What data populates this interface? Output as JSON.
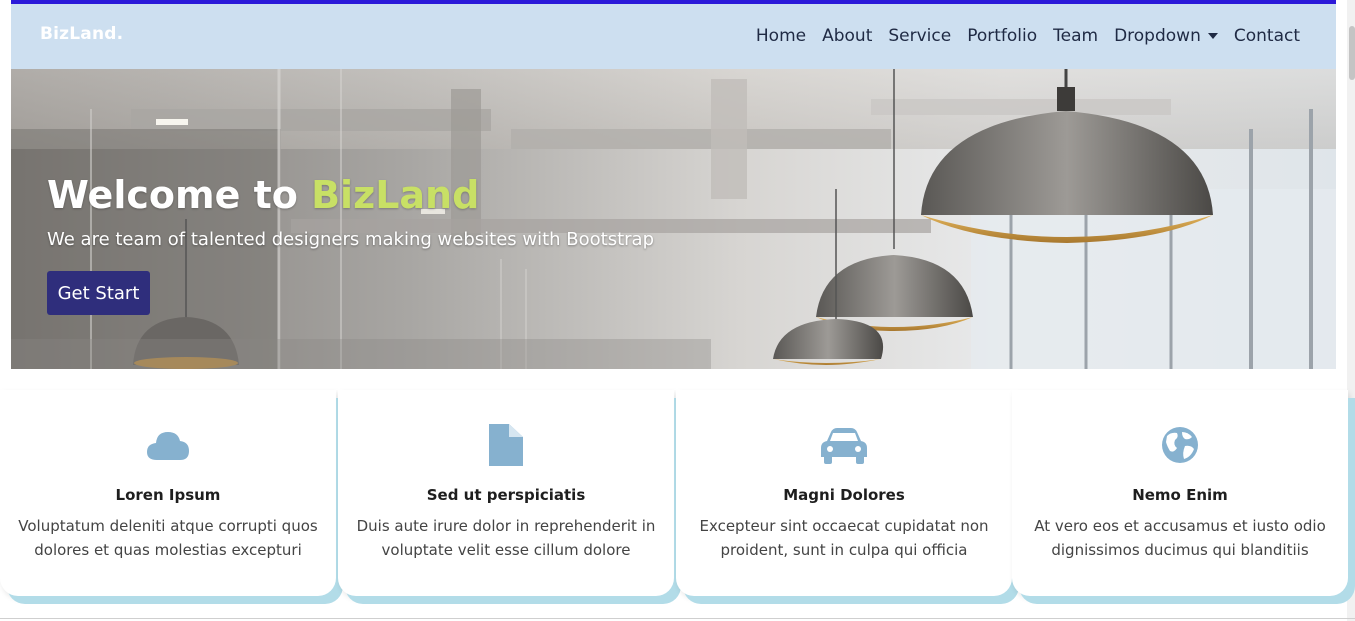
{
  "navbar": {
    "brand": "BizLand.",
    "items": [
      {
        "label": "Home"
      },
      {
        "label": "About"
      },
      {
        "label": "Service"
      },
      {
        "label": "Portfolio"
      },
      {
        "label": "Team"
      },
      {
        "label": "Dropdown"
      },
      {
        "label": "Contact"
      }
    ]
  },
  "hero": {
    "title_prefix": "Welcome to ",
    "title_accent": "BizLand",
    "subtitle": "We are team of talented designers making websites with Bootstrap",
    "cta_label": "Get Start"
  },
  "cards": [
    {
      "icon": "cloud-icon",
      "title": "Loren Ipsum",
      "text": "Voluptatum deleniti atque corrupti quos dolores et quas molestias excepturi"
    },
    {
      "icon": "file-icon",
      "title": "Sed ut perspiciatis",
      "text": "Duis aute irure dolor in reprehenderit in voluptate velit esse cillum dolore"
    },
    {
      "icon": "car-icon",
      "title": "Magni Dolores",
      "text": "Excepteur sint occaecat cupidatat non proident, sunt in culpa qui officia"
    },
    {
      "icon": "globe-icon",
      "title": "Nemo Enim",
      "text": "At vero eos et accusamus et iusto odio dignissimos ducimus qui blanditiis"
    }
  ],
  "colors": {
    "accent_line": "#2b19d9",
    "navbar_bg": "#cddff0",
    "hero_accent": "#c8e065",
    "button_bg": "#2f2e7c",
    "icon_color": "#86b1cf",
    "card_shadow": "#b2dce8"
  }
}
